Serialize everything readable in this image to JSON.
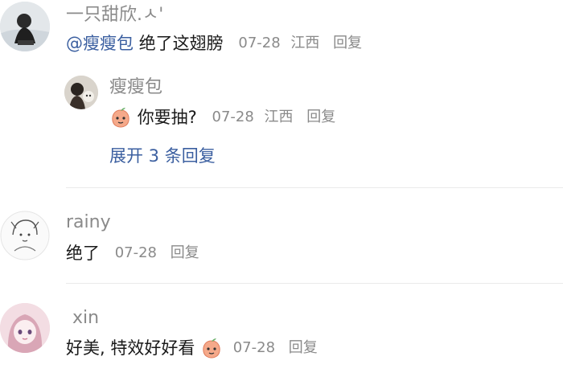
{
  "comments": [
    {
      "username": "一只甜欣.ㅅ'",
      "mention": "@瘦瘦包",
      "text": "绝了这翅膀",
      "date": "07-28",
      "location": "江西",
      "reply_label": "回复",
      "replies": [
        {
          "username": "瘦瘦包",
          "emoji": "peach-emoji",
          "text": "你要抽?",
          "date": "07-28",
          "location": "江西",
          "reply_label": "回复"
        }
      ],
      "expand_label": "展开 3 条回复"
    },
    {
      "username": "rainy",
      "text": "绝了",
      "date": "07-28",
      "reply_label": "回复"
    },
    {
      "username": "xin",
      "text": "好美, 特效好好看",
      "emoji": "peach-emoji",
      "date": "07-28",
      "reply_label": "回复"
    }
  ],
  "colors": {
    "link": "#3b5fa0",
    "meta": "#8a8a8a",
    "divider": "#ebebeb"
  }
}
